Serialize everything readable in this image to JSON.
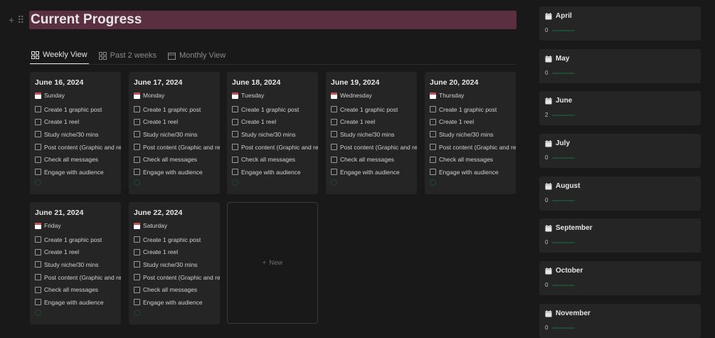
{
  "page": {
    "title": "Current Progress"
  },
  "tabs": [
    {
      "label": "Weekly View",
      "icon": "gallery-icon",
      "active": true
    },
    {
      "label": "Past 2 weeks",
      "icon": "gallery-icon",
      "active": false
    },
    {
      "label": "Monthly View",
      "icon": "calendar-icon",
      "active": false
    }
  ],
  "cards": [
    {
      "date": "June 16, 2024",
      "day": "Sunday"
    },
    {
      "date": "June 17, 2024",
      "day": "Monday"
    },
    {
      "date": "June 18, 2024",
      "day": "Tuesday"
    },
    {
      "date": "June 19, 2024",
      "day": "Wednesday"
    },
    {
      "date": "June 20, 2024",
      "day": "Thursday"
    },
    {
      "date": "June 21, 2024",
      "day": "Friday"
    },
    {
      "date": "June 22, 2024",
      "day": "Saturday"
    }
  ],
  "tasks": [
    "Create 1 graphic post",
    "Create 1 reel",
    "Study niche/30 mins",
    "Post content (Graphic and reel)",
    "Check all messages",
    "Engage with audience"
  ],
  "new_card": {
    "label": "New"
  },
  "months": [
    {
      "name": "April",
      "count": "0"
    },
    {
      "name": "May",
      "count": "0"
    },
    {
      "name": "June",
      "count": "2"
    },
    {
      "name": "July",
      "count": "0"
    },
    {
      "name": "August",
      "count": "0"
    },
    {
      "name": "September",
      "count": "0"
    },
    {
      "name": "October",
      "count": "0"
    },
    {
      "name": "November",
      "count": "0"
    }
  ],
  "colors": {
    "accent_title_bg": "#5a2f40",
    "progress_ring": "#1f4a33",
    "card_bg": "#252525",
    "page_bg": "#191919"
  }
}
